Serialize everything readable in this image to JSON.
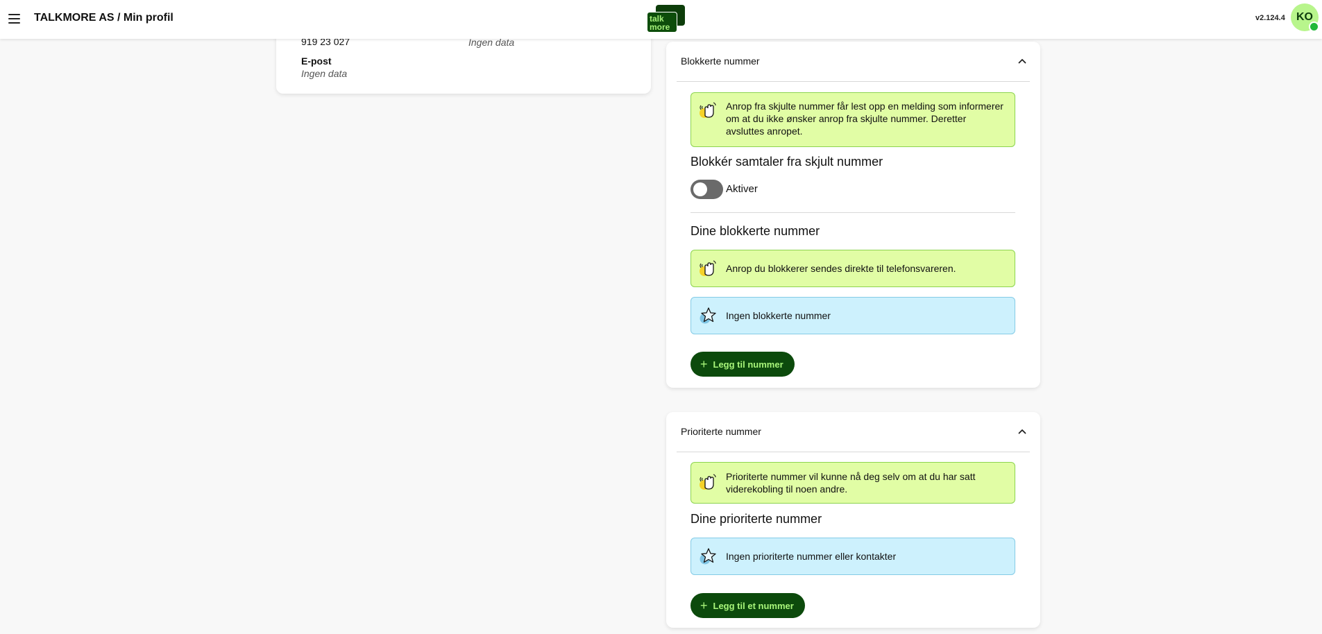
{
  "header": {
    "breadcrumb": "TALKMORE AS / Min profil",
    "logo_line1": "talk",
    "logo_line2": "more",
    "version": "v2.124.4",
    "avatar_initials": "KO"
  },
  "profile": {
    "phone": "919 23 027",
    "other_value": "Ingen data",
    "email_label": "E-post",
    "email_value": "Ingen data"
  },
  "blocked": {
    "title": "Blokkerte nummer",
    "hidden_info": "Anrop fra skjulte nummer får lest opp en melding som informerer om at du ikke ønsker anrop fra skjulte nummer. Deretter avsluttes anropet.",
    "block_hidden_title": "Blokkér samtaler fra skjult nummer",
    "toggle_label": "Aktiver",
    "your_blocked_title": "Dine blokkerte nummer",
    "blocked_info": "Anrop du blokkerer sendes direkte til telefonsvareren.",
    "empty_text": "Ingen blokkerte nummer",
    "add_button": "Legg til nummer"
  },
  "priority": {
    "title": "Prioriterte nummer",
    "info": "Prioriterte nummer vil kunne nå deg selv om at du har satt viderekobling til noen andre.",
    "your_title": "Dine prioriterte nummer",
    "empty_text": "Ingen prioriterte nummer eller kontakter",
    "add_button": "Legg til et nummer"
  },
  "colors": {
    "brand_dark_green": "#0c4a0c",
    "brand_light_green": "#a8f57a",
    "info_green_bg": "#e1fda5",
    "info_blue_bg": "#cdf1fd",
    "avatar_bg": "#b8f58c",
    "status_dot": "#22b83a"
  },
  "icons": {
    "menu": "hamburger-menu-icon",
    "collapse": "chevron-up-icon",
    "info": "waving-hand-icon",
    "empty": "star-icon",
    "add": "plus-icon"
  }
}
